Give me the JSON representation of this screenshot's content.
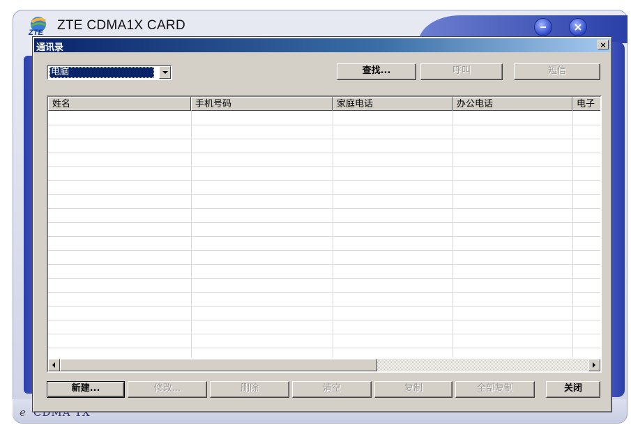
{
  "app": {
    "title": "ZTE CDMA1X CARD",
    "status_text": "CDMA 1X",
    "logo_text": "ZTE",
    "minimize_icon": "minimize-icon",
    "close_icon": "close-icon"
  },
  "dialog": {
    "title": "通讯录",
    "close_label": "×",
    "source_select": {
      "value": "电脑"
    },
    "top_buttons": [
      {
        "label": "查找...",
        "enabled": true
      },
      {
        "label": "呼叫",
        "enabled": false
      },
      {
        "label": "短信",
        "enabled": false
      }
    ],
    "table": {
      "columns": [
        "姓名",
        "手机号码",
        "家庭电话",
        "办公电话",
        "电子"
      ],
      "rows": []
    },
    "bottom_buttons": [
      {
        "label": "新建...",
        "enabled": true
      },
      {
        "label": "修改...",
        "enabled": false
      },
      {
        "label": "删除",
        "enabled": false
      },
      {
        "label": "清空",
        "enabled": false
      },
      {
        "label": "复制",
        "enabled": false
      },
      {
        "label": "全部复制",
        "enabled": false
      },
      {
        "label": "关闭",
        "enabled": true
      }
    ]
  },
  "colors": {
    "dialog_face": "#d4d0c8",
    "titlebar_start": "#0a246a",
    "titlebar_end": "#a6caf0",
    "app_blue": "#2a3fa8"
  }
}
